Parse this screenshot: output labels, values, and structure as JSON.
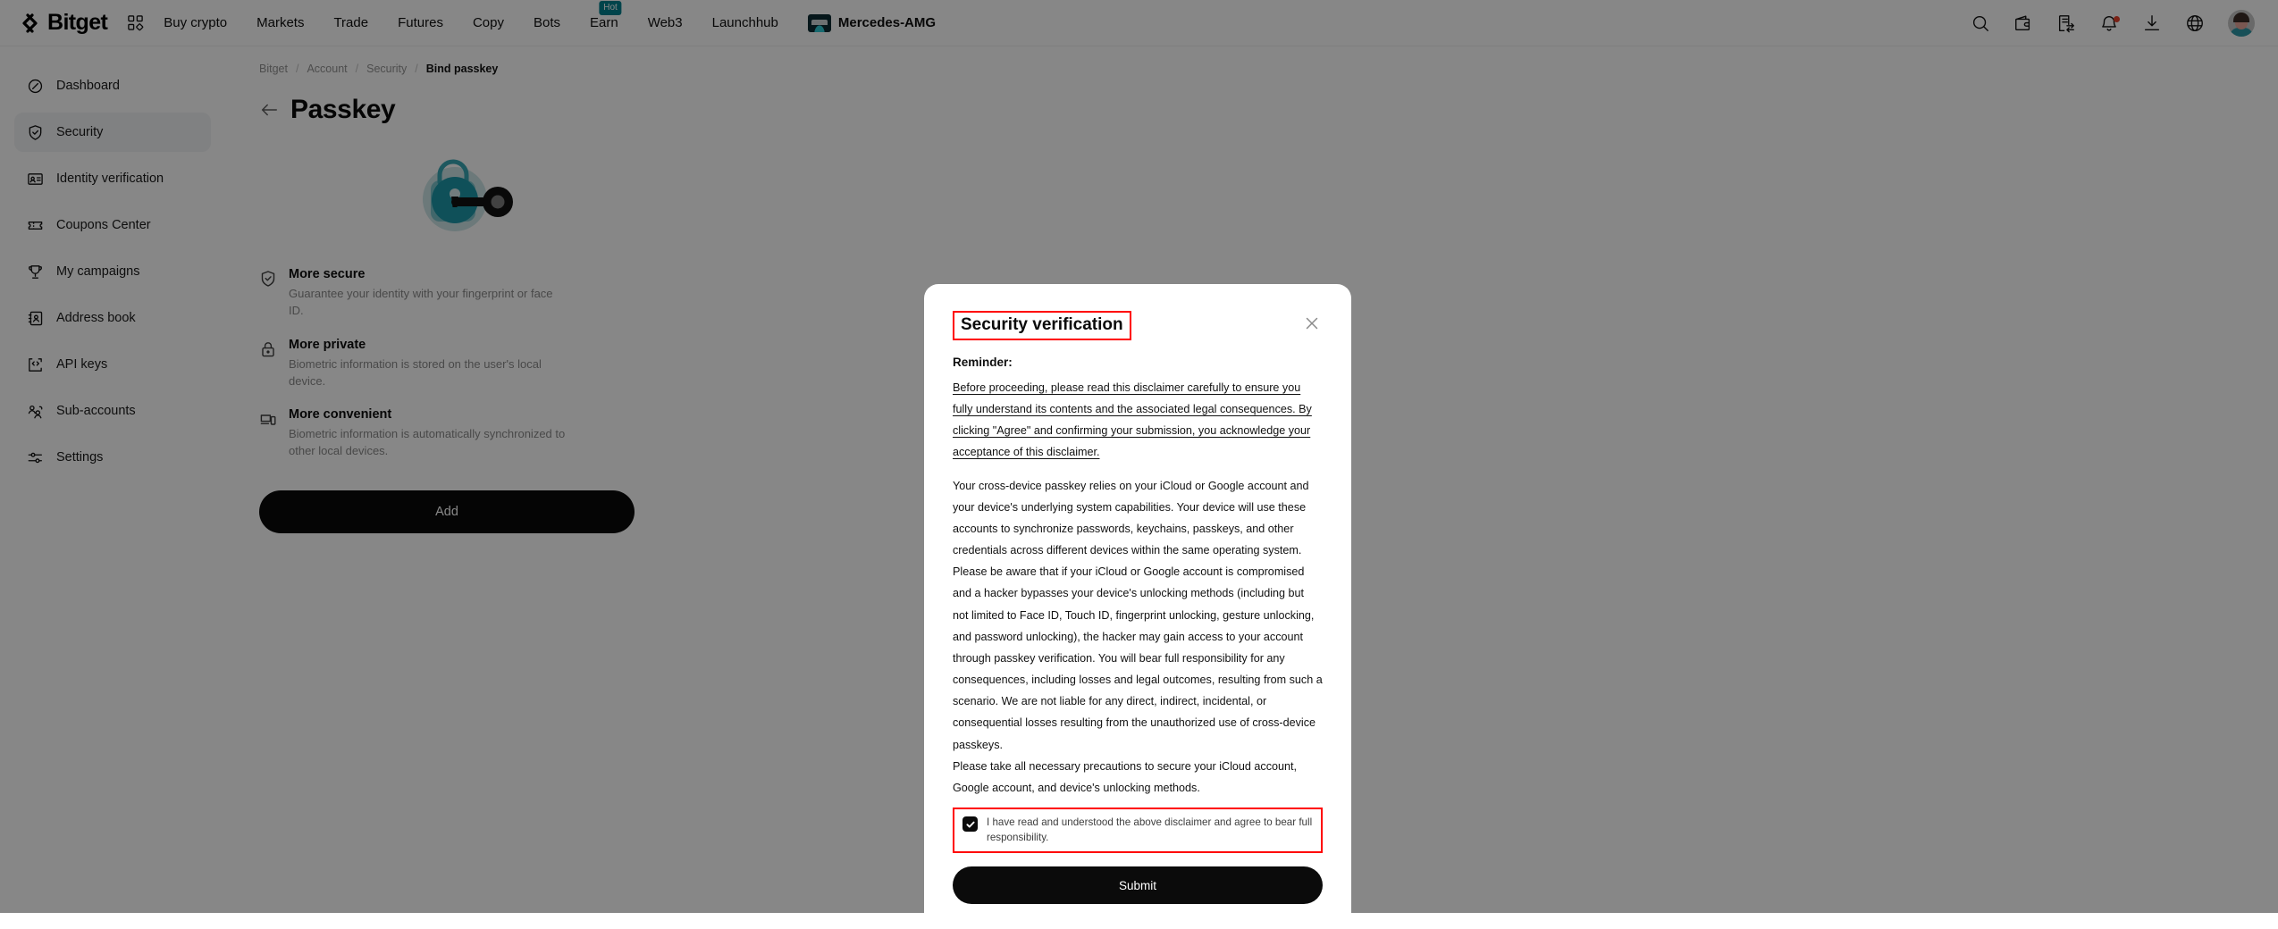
{
  "topnav": {
    "brand": "Bitget",
    "grid_icon": "grid-apps-icon",
    "items": [
      {
        "label": "Buy crypto",
        "badge": null
      },
      {
        "label": "Markets",
        "badge": null
      },
      {
        "label": "Trade",
        "badge": null
      },
      {
        "label": "Futures",
        "badge": null
      },
      {
        "label": "Copy",
        "badge": null
      },
      {
        "label": "Bots",
        "badge": null
      },
      {
        "label": "Earn",
        "badge": "Hot"
      },
      {
        "label": "Web3",
        "badge": null
      },
      {
        "label": "Launchhub",
        "badge": null
      }
    ],
    "promo": {
      "label": "Mercedes-AMG"
    },
    "right_icons": [
      "search-icon",
      "wallet-icon",
      "orders-icon",
      "notification-bell-icon",
      "download-icon",
      "language-globe-icon",
      "avatar"
    ]
  },
  "sidebar": {
    "items": [
      {
        "label": "Dashboard",
        "icon": "compass-icon",
        "active": false
      },
      {
        "label": "Security",
        "icon": "shield-check-icon",
        "active": true
      },
      {
        "label": "Identity verification",
        "icon": "id-card-icon",
        "active": false
      },
      {
        "label": "Coupons Center",
        "icon": "ticket-icon",
        "active": false
      },
      {
        "label": "My campaigns",
        "icon": "trophy-icon",
        "active": false
      },
      {
        "label": "Address book",
        "icon": "address-book-icon",
        "active": false
      },
      {
        "label": "API keys",
        "icon": "code-brackets-icon",
        "active": false
      },
      {
        "label": "Sub-accounts",
        "icon": "users-icon",
        "active": false
      },
      {
        "label": "Settings",
        "icon": "sliders-icon",
        "active": false
      }
    ]
  },
  "breadcrumb": {
    "items": [
      "Bitget",
      "Account",
      "Security",
      "Bind passkey"
    ],
    "separator": "/"
  },
  "page": {
    "title": "Passkey",
    "back_icon": "back-arrow-icon",
    "hero_icon": "padlock-key-illustration",
    "features": [
      {
        "icon": "shield-check-icon",
        "title": "More secure",
        "desc": "Guarantee your identity with your fingerprint or face ID."
      },
      {
        "icon": "lock-icon",
        "title": "More private",
        "desc": "Biometric information is stored on the user's local device."
      },
      {
        "icon": "devices-icon",
        "title": "More convenient",
        "desc": "Biometric information is automatically synchronized to other local devices."
      }
    ],
    "add_button": "Add"
  },
  "modal": {
    "title": "Security verification",
    "close_icon": "close-icon",
    "reminder_label": "Reminder:",
    "disclaimer_underlined": "Before proceeding, please read this disclaimer carefully to ensure you fully understand its contents and the associated legal consequences. By clicking \"Agree\" and confirming your submission, you acknowledge your acceptance of this disclaimer.",
    "paragraphs": [
      "Your cross-device passkey relies on your iCloud or Google account and your device's underlying system capabilities. Your device will use these accounts to synchronize passwords, keychains, passkeys, and other credentials across different devices within the same operating system.",
      "Please be aware that if your iCloud or Google account is compromised and a hacker bypasses your device's unlocking methods (including but not limited to Face ID, Touch ID, fingerprint unlocking, gesture unlocking, and password unlocking), the hacker may gain access to your account through passkey verification. You will bear full responsibility for any consequences, including losses and legal outcomes, resulting from such a scenario. We are not liable for any direct, indirect, incidental, or consequential losses resulting from the unauthorized use of cross-device passkeys.",
      "Please take all necessary precautions to secure your iCloud account, Google account, and device's unlocking methods."
    ],
    "consent_label": "I have read and understood the above disclaimer and agree to bear full responsibility.",
    "consent_checked": true,
    "submit_label": "Submit"
  },
  "colors": {
    "accent_teal": "#01808e",
    "annotation_red": "#ff0000",
    "dark_button": "#0b0b0b",
    "notification_dot": "#e8402a"
  }
}
